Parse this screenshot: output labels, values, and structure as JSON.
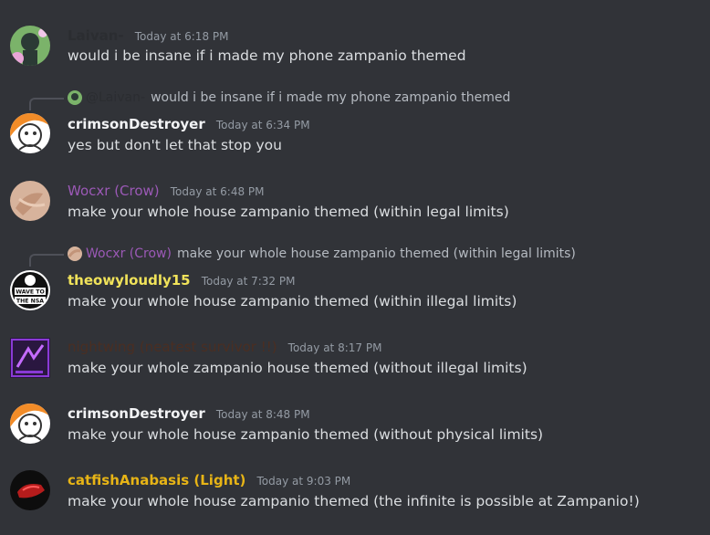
{
  "colors": {
    "background": "#313338",
    "text": "#dbdee1",
    "timestamp": "#949ba4",
    "name_default": "#ffffff",
    "name_purple": "#9b59b6",
    "name_yellow": "#f1c40f",
    "name_gold": "#e7b416",
    "name_dark": "#4a2e22"
  },
  "messages": [
    {
      "author": "Laivan-",
      "timestamp": "Today at 6:18 PM",
      "content": "would i be insane if i made my phone zampanio themed",
      "avatar_icon": "laivan-avatar-icon"
    },
    {
      "reply": {
        "author": "@Laivan-",
        "content": "would i be insane if i made my phone zampanio themed"
      },
      "author": "crimsonDestroyer",
      "timestamp": "Today at 6:34 PM",
      "content": "yes but don't let that stop you",
      "avatar_icon": "crimson-avatar-icon"
    },
    {
      "author": "Wocxr (Crow)",
      "timestamp": "Today at 6:48 PM",
      "content": "make your whole house zampanio themed (within legal limits)",
      "avatar_icon": "wocxr-avatar-icon"
    },
    {
      "reply": {
        "author": "Wocxr (Crow)",
        "content": "make your whole house zampanio themed (within legal limits)"
      },
      "author": "theowyloudly15",
      "timestamp": "Today at 7:32 PM",
      "content": "make your whole house zampanio themed (within illegal limits)",
      "avatar_icon": "wave-to-nsa-avatar-icon",
      "avatar_text": "WAVE TO THE NSA"
    },
    {
      "author": "nightwing (neatest survivor !!)",
      "timestamp": "Today at 8:17 PM",
      "content": "make your whole zampanio house themed (without illegal limits)",
      "avatar_icon": "nightwing-avatar-icon"
    },
    {
      "author": "crimsonDestroyer",
      "timestamp": "Today at 8:48 PM",
      "content": "make your whole house zampanio themed (without physical limits)",
      "avatar_icon": "crimson-avatar-icon"
    },
    {
      "author": "catfishAnabasis (Light)",
      "timestamp": "Today at 9:03 PM",
      "content": "make your whole house zampanio themed (the infinite is possible at Zampanio!)",
      "avatar_icon": "catfish-avatar-icon"
    }
  ]
}
